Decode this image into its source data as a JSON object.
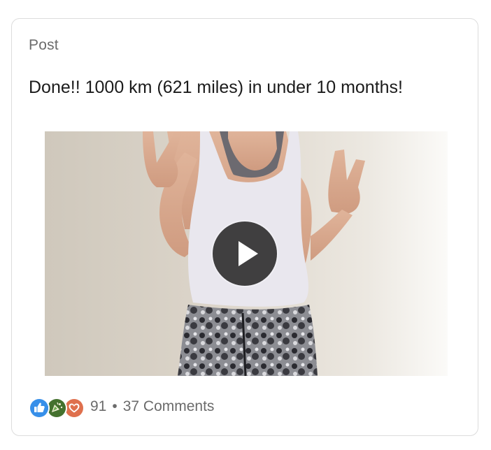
{
  "post": {
    "label": "Post",
    "text": "Done!! 1000 km (621 miles) in under 10 months!"
  },
  "media": {
    "type": "video",
    "play_icon": "play-icon"
  },
  "footer": {
    "reaction_icons": [
      "like-reaction-icon",
      "celebrate-reaction-icon",
      "love-reaction-icon"
    ],
    "reaction_colors": [
      "#378fe9",
      "#44712e",
      "#df704d"
    ],
    "reaction_count": "91",
    "separator": "•",
    "comments": "37 Comments"
  }
}
